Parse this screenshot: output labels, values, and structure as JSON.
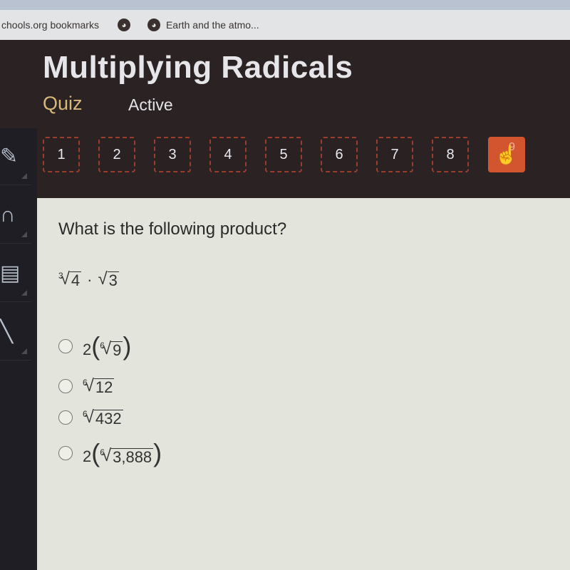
{
  "browser": {
    "bookmarks": [
      {
        "label": "chools.org bookmarks",
        "icon": "none"
      },
      {
        "label": "",
        "icon": "globe-icon"
      },
      {
        "label": "Earth and the atmo...",
        "icon": "globe-icon"
      }
    ]
  },
  "header": {
    "title": "Multiplying Radicals",
    "type_label": "Quiz",
    "status_label": "Active"
  },
  "question_nav": {
    "items": [
      "1",
      "2",
      "3",
      "4",
      "5",
      "6",
      "7",
      "8",
      "9"
    ],
    "current": "9",
    "current_icon": "hand-pointer-icon"
  },
  "sidebar": {
    "icons": [
      "pencil-icon",
      "headphones-icon",
      "calculator-icon",
      "pen-icon"
    ]
  },
  "question": {
    "prompt": "What is the following product?",
    "expression": {
      "term1": {
        "index": "3",
        "radicand": "4"
      },
      "operator": "·",
      "term2": {
        "index": "",
        "radicand": "3"
      }
    },
    "options": [
      {
        "coefficient": "2",
        "index": "6",
        "radicand": "9",
        "parenthesized": true
      },
      {
        "coefficient": "",
        "index": "6",
        "radicand": "12",
        "parenthesized": false
      },
      {
        "coefficient": "",
        "index": "6",
        "radicand": "432",
        "parenthesized": false
      },
      {
        "coefficient": "2",
        "index": "6",
        "radicand": "3,888",
        "parenthesized": true
      }
    ],
    "selected": null
  },
  "colors": {
    "header_bg": "#2b2323",
    "accent_orange": "#d2552f",
    "quiz_label": "#d8b97a",
    "content_bg": "#e3e4db"
  }
}
